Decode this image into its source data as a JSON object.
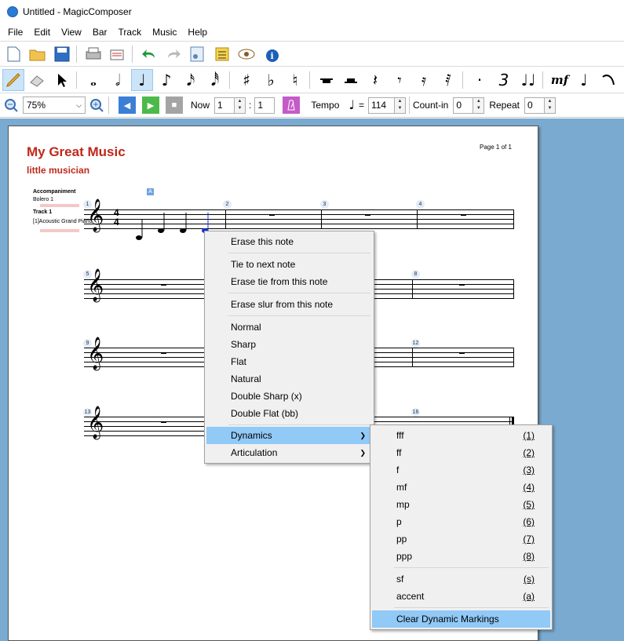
{
  "window": {
    "title": "Untitled - MagicComposer"
  },
  "menu": [
    "File",
    "Edit",
    "View",
    "Bar",
    "Track",
    "Music",
    "Help"
  ],
  "toolbar": {
    "zoom": "75%",
    "now_label": "Now",
    "now_bar": "1",
    "now_sep": ":",
    "now_beat": "1",
    "tempo_label": "Tempo",
    "tempo_eq": "=",
    "tempo_value": "114",
    "countin_label": "Count-in",
    "countin_value": "0",
    "repeat_label": "Repeat",
    "repeat_value": "0",
    "mf_label": "mf"
  },
  "score": {
    "title": "My Great Music",
    "subtitle": "little musician",
    "page_label": "Page 1 of 1",
    "accompaniment_label": "Accompaniment",
    "accompaniment_style": "Bolero 1",
    "track_label": "Track 1",
    "track_instrument": "[1]Acoustic Grand Piano",
    "marker": "A",
    "bar_numbers": [
      "1",
      "2",
      "3",
      "4",
      "5",
      "8",
      "9",
      "12",
      "13",
      "16"
    ]
  },
  "context_menu": {
    "items": [
      "Erase this note",
      "Tie to next note",
      "Erase tie from this note",
      "Erase slur from this note",
      "Normal",
      "Sharp",
      "Flat",
      "Natural",
      "Double Sharp (x)",
      "Double Flat (bb)",
      "Dynamics",
      "Articulation"
    ]
  },
  "dynamics_menu": {
    "items": [
      {
        "label": "fff",
        "key": "(1)"
      },
      {
        "label": "ff",
        "key": "(2)"
      },
      {
        "label": "f",
        "key": "(3)"
      },
      {
        "label": "mf",
        "key": "(4)"
      },
      {
        "label": "mp",
        "key": "(5)"
      },
      {
        "label": "p",
        "key": "(6)"
      },
      {
        "label": "pp",
        "key": "(7)"
      },
      {
        "label": "ppp",
        "key": "(8)"
      },
      {
        "label": "sf",
        "key": "(s)"
      },
      {
        "label": "accent",
        "key": "(a)"
      },
      {
        "label": "Clear Dynamic Markings",
        "key": ""
      }
    ]
  },
  "icons": {
    "clef": "𝄞"
  }
}
